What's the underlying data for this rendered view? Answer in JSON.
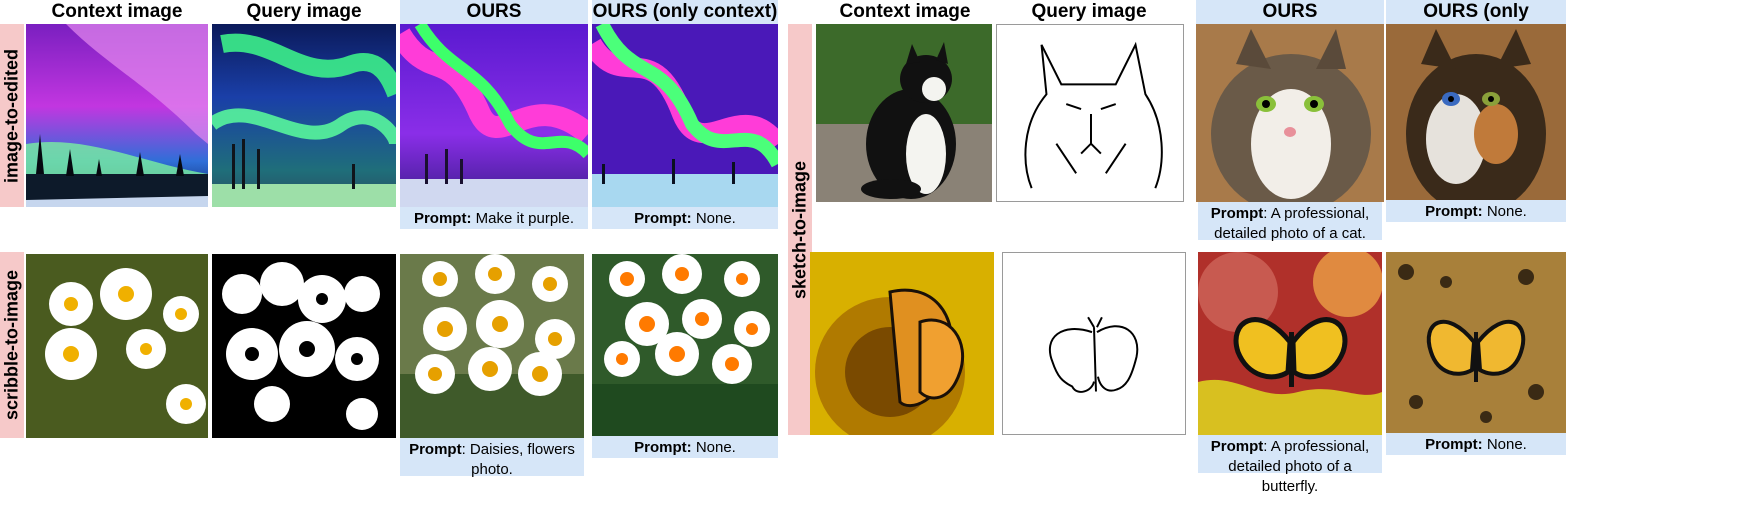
{
  "headers": {
    "context": "Context image",
    "query": "Query image",
    "ours": "OURS",
    "ours_context": "OURS (only context)"
  },
  "tasks": {
    "image_to_edited": "image-to-edited",
    "scribble_to_image": "scribble-to-image",
    "sketch_to_image": "sketch-to-image"
  },
  "captions": {
    "prompt_label": "Prompt:",
    "prompt_label_plain": "Prompt",
    "aurora_ours": "Make it purple.",
    "none": "None.",
    "daisy_ours_l1": "Daisies, flowers",
    "daisy_ours_l2": "photo.",
    "cat_ours_l1": "A professional,",
    "cat_ours_l2": "detailed photo of a cat.",
    "butterfly_ours_l1": "A professional,",
    "butterfly_ours_l2": "detailed photo of a butterfly."
  }
}
